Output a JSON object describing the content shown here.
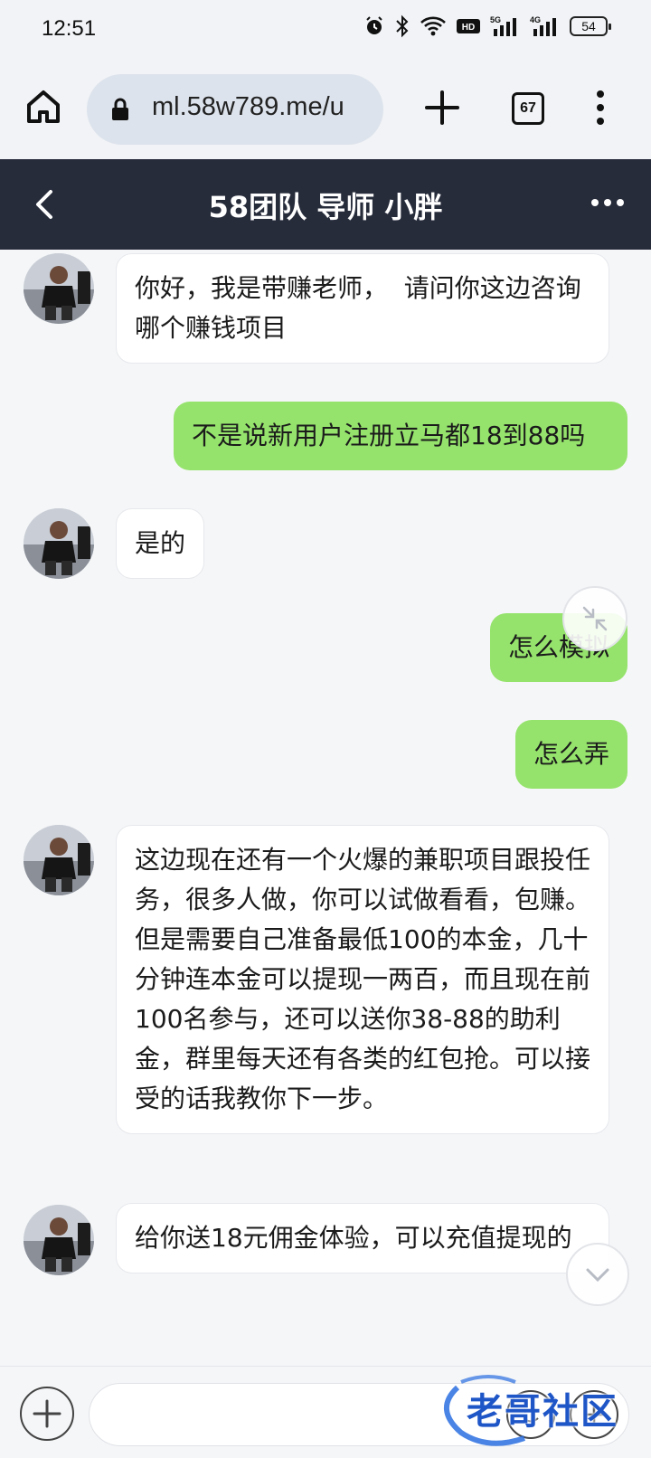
{
  "status_bar": {
    "time": "12:51",
    "battery": "54",
    "icons": [
      "alarm-icon",
      "bluetooth-icon",
      "wifi-icon",
      "hd-icon",
      "5g-signal-icon",
      "4g-signal-icon",
      "battery-icon"
    ]
  },
  "browser": {
    "url": "ml.58w789.me/u",
    "tab_count": "67"
  },
  "chat": {
    "title": "58团队 导师 小胖",
    "messages": [
      {
        "side": "left",
        "text": "你好，我是带赚老师，  请问你这边咨询哪个赚钱项目"
      },
      {
        "side": "right",
        "text": "不是说新用户注册立马都18到88吗"
      },
      {
        "side": "left",
        "text": "是的"
      },
      {
        "side": "right",
        "text": "怎么模拟"
      },
      {
        "side": "right",
        "text": "怎么弄"
      },
      {
        "side": "left",
        "text": "这边现在还有一个火爆的兼职项目跟投任务，很多人做，你可以试做看看，包赚。\n但是需要自己准备最低100的本金，几十分钟连本金可以提现一两百，而且现在前100名参与，还可以送你38-88的助利金，群里每天还有各类的红包抢。可以接受的话我教你下一步。"
      },
      {
        "side": "left",
        "text": "给你送18元佣金体验，可以充值提现的"
      }
    ]
  },
  "input": {
    "placeholder": ""
  },
  "watermark": {
    "text": "老哥社区"
  },
  "colors": {
    "header_bg": "#272c3b",
    "right_bubble": "#95e36c",
    "left_bubble": "#ffffff",
    "page_bg": "#f5f6f8"
  }
}
